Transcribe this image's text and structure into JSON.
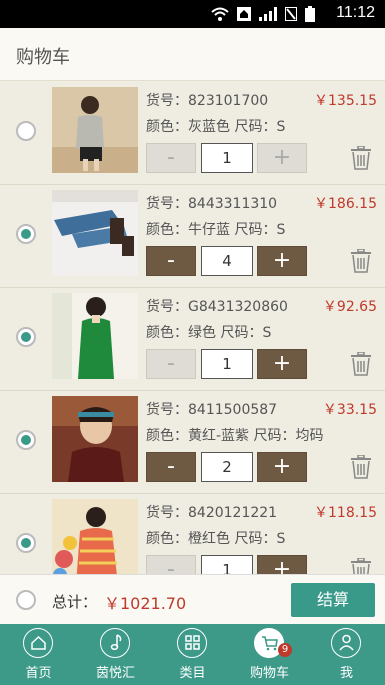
{
  "status_bar": {
    "time": "11:12"
  },
  "header": {
    "title": "购物车"
  },
  "items": [
    {
      "code": "货号：823101700",
      "color_size": "颜色：灰蓝色 尺码：S",
      "price": "￥135.15",
      "qty": "1",
      "selected": false,
      "minus_active": false,
      "plus_active": false
    },
    {
      "code": "货号：8443311310",
      "color_size": "颜色：牛仔蓝 尺码：S",
      "price": "￥186.15",
      "qty": "4",
      "selected": true,
      "minus_active": true,
      "plus_active": true
    },
    {
      "code": "货号：G8431320860",
      "color_size": "颜色：绿色 尺码：S",
      "price": "￥92.65",
      "qty": "1",
      "selected": true,
      "minus_active": false,
      "plus_active": true
    },
    {
      "code": "货号：8411500587",
      "color_size": "颜色：黄红-蓝紫 尺码：均码",
      "price": "￥33.15",
      "qty": "2",
      "selected": true,
      "minus_active": true,
      "plus_active": true
    },
    {
      "code": "货号：8420121221",
      "color_size": "颜色：橙红色 尺码：S",
      "price": "￥118.15",
      "qty": "1",
      "selected": true,
      "minus_active": false,
      "plus_active": true
    }
  ],
  "buttons": {
    "minus": "-",
    "plus": "+"
  },
  "footer": {
    "total_label": "总计：",
    "total_value": "￥1021.70",
    "checkout": "结算"
  },
  "tabs": [
    {
      "label": "首页",
      "icon": "home-icon"
    },
    {
      "label": "茵悦汇",
      "icon": "music-note-icon"
    },
    {
      "label": "类目",
      "icon": "grid-icon"
    },
    {
      "label": "购物车",
      "icon": "cart-icon",
      "badge": "9"
    },
    {
      "label": "我",
      "icon": "person-icon"
    }
  ],
  "colors": {
    "accent": "#3a9a8a",
    "price": "#c0392b",
    "stepper": "#6e5a43"
  }
}
